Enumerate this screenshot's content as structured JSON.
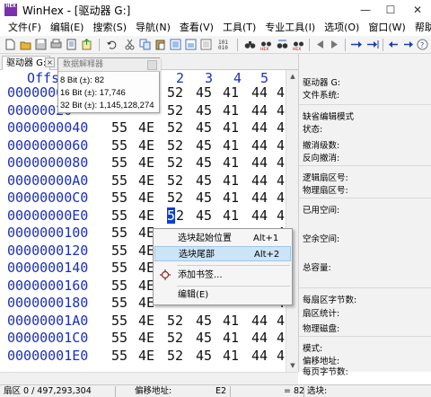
{
  "app": {
    "logo_text": "HEX",
    "title": "WinHex - [驱动器 G:]",
    "accent_color": "#1a2fbf",
    "selection_color": "#0a3fd0"
  },
  "window_controls": {
    "minimize": "—",
    "maximize": "☐",
    "close": "✕"
  },
  "menu": [
    {
      "label": "文件(F)"
    },
    {
      "label": "编辑(E)"
    },
    {
      "label": "搜索(S)"
    },
    {
      "label": "导航(N)"
    },
    {
      "label": "查看(V)"
    },
    {
      "label": "工具(T)"
    },
    {
      "label": "专业工具(I)"
    },
    {
      "label": "选项(O)"
    },
    {
      "label": "窗口(W)"
    },
    {
      "label": "帮助(H)"
    }
  ],
  "toolbar": {
    "icons": [
      "new-file-icon",
      "open-file-icon",
      "save-icon",
      "print-icon",
      "properties-icon",
      "export-icon",
      "undo-icon",
      "cut-icon",
      "copy-icon",
      "paste-icon",
      "paste-special-icon",
      "binary-convert-icon",
      "find-icon",
      "find-hex-icon",
      "replace-icon",
      "replace-hex-icon",
      "goto-offset-icon",
      "goto-icon",
      "go-left-icon",
      "go-right-icon",
      "go-back-icon",
      "go-forward-icon",
      "arrow-right-icon",
      "goto-mark-icon",
      "previous-icon",
      "next-icon",
      "help-icon"
    ]
  },
  "tab": {
    "label": "驱动器 G:",
    "close": "×"
  },
  "hex": {
    "header": "Offs",
    "header_cols": [
      "2",
      "3",
      "4",
      "5"
    ],
    "rows": [
      {
        "offset": "00000000",
        "bytes": [
          "",
          "",
          "52",
          "45",
          "41",
          "44",
          "4"
        ]
      },
      {
        "offset": "00000020",
        "bytes": [
          "",
          "",
          "52",
          "45",
          "41",
          "44",
          "4"
        ]
      },
      {
        "offset": "0000000040",
        "bytes": [
          "55",
          "4E",
          "52",
          "45",
          "41",
          "44",
          "4"
        ]
      },
      {
        "offset": "0000000060",
        "bytes": [
          "55",
          "4E",
          "52",
          "45",
          "41",
          "44",
          "4"
        ]
      },
      {
        "offset": "0000000080",
        "bytes": [
          "55",
          "4E",
          "52",
          "45",
          "41",
          "44",
          "4"
        ]
      },
      {
        "offset": "00000000A0",
        "bytes": [
          "55",
          "4E",
          "52",
          "45",
          "41",
          "44",
          "4"
        ]
      },
      {
        "offset": "00000000C0",
        "bytes": [
          "55",
          "4E",
          "52",
          "45",
          "41",
          "44",
          "4"
        ]
      },
      {
        "offset": "00000000E0",
        "bytes": [
          "55",
          "4E",
          "5",
          "2",
          "45",
          "41",
          "44",
          "4"
        ]
      },
      {
        "offset": "0000000100",
        "bytes": [
          "55",
          "4E",
          "",
          "",
          "",
          "",
          "4"
        ]
      },
      {
        "offset": "0000000120",
        "bytes": [
          "55",
          "4E",
          "",
          "",
          "",
          "",
          "4"
        ]
      },
      {
        "offset": "0000000140",
        "bytes": [
          "55",
          "4E",
          "",
          "",
          "",
          "",
          "4"
        ]
      },
      {
        "offset": "0000000160",
        "bytes": [
          "55",
          "4E",
          "",
          "",
          "",
          "",
          "4"
        ]
      },
      {
        "offset": "0000000180",
        "bytes": [
          "55",
          "4E",
          "",
          "",
          "",
          "",
          "4"
        ]
      },
      {
        "offset": "00000001A0",
        "bytes": [
          "55",
          "4E",
          "52",
          "45",
          "41",
          "44",
          "4"
        ]
      },
      {
        "offset": "00000001C0",
        "bytes": [
          "55",
          "4E",
          "52",
          "45",
          "41",
          "44",
          "4"
        ]
      },
      {
        "offset": "00000001E0",
        "bytes": [
          "55",
          "4E",
          "52",
          "45",
          "41",
          "44",
          "4"
        ]
      }
    ]
  },
  "interpreter": {
    "title": "数据解释器",
    "lines": [
      "8 Bit (±): 82",
      "16 Bit (±): 17,746",
      "32 Bit (±): 1,145,128,274"
    ]
  },
  "context_menu": {
    "items": [
      {
        "label": "选块起始位置",
        "shortcut": "Alt+1"
      },
      {
        "label": "选块尾部",
        "shortcut": "Alt+2"
      },
      {
        "label": "添加书签...",
        "shortcut": ""
      },
      {
        "label": "编辑(E)",
        "shortcut": ""
      }
    ]
  },
  "info_panel": {
    "drive_label": "驱动器 G:",
    "file_system": "文件系统:",
    "default_edit_mode": "缺省编辑模式",
    "status": "状态:",
    "undo_level": "撤消级数:",
    "reverse_undo": "反向撤消:",
    "logical_sector": "逻辑扇区号:",
    "physical_sector": "物理扇区号:",
    "used_space": "已用空间:",
    "free_space": "空余空间:",
    "total_capacity": "总容量:",
    "bytes_per_sector": "每扇区字节数:",
    "sector_count": "扇区统计:",
    "physical_disk": "物理磁盘:",
    "mode": "模式:",
    "offset_address": "偏移地址:",
    "bytes_per_page": "每页字节数:"
  },
  "status_bar": {
    "sector": "扇区 0 / 497,293,304",
    "offset_label": "偏移地址:",
    "offset_value": "E2",
    "value": "= 82",
    "block_label": "选块:"
  }
}
